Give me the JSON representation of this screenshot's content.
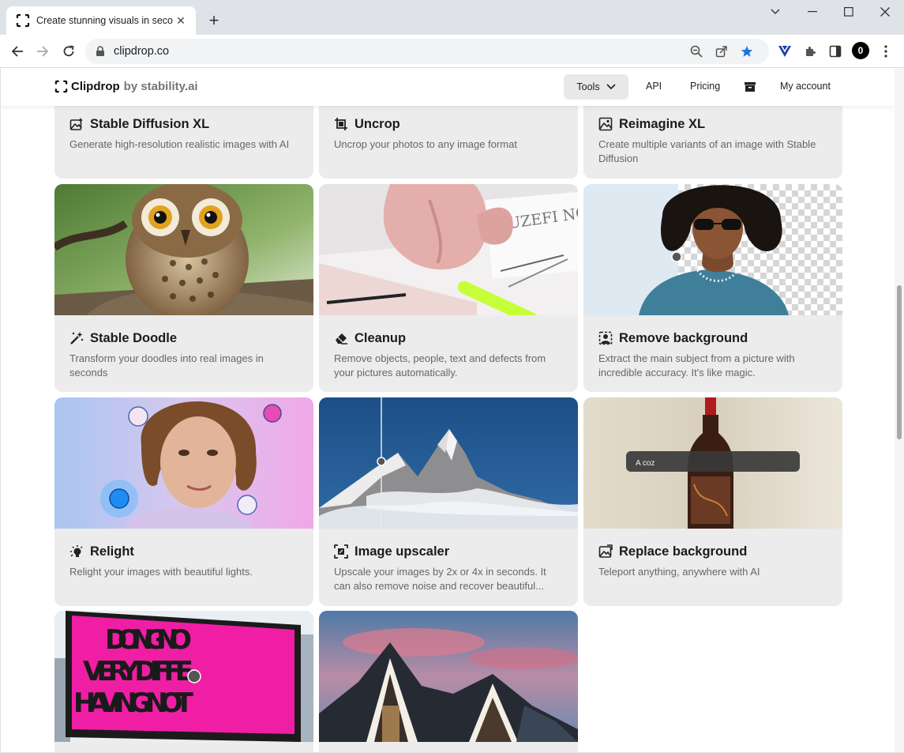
{
  "browser": {
    "tab_title": "Create stunning visuals in seco",
    "url": "clipdrop.co",
    "profile_initial": "0"
  },
  "header": {
    "brand": "Clipdrop",
    "by": "by stability.ai",
    "nav": {
      "tools": "Tools",
      "api": "API",
      "pricing": "Pricing",
      "account": "My account"
    }
  },
  "cards": [
    {
      "title": "Stable Diffusion XL",
      "desc": "Generate high-resolution realistic images with AI"
    },
    {
      "title": "Uncrop",
      "desc": "Uncrop your photos to any image format"
    },
    {
      "title": "Reimagine XL",
      "desc": "Create multiple variants of an image with Stable Diffusion"
    },
    {
      "title": "Stable Doodle",
      "desc": "Transform your doodles into real images in seconds"
    },
    {
      "title": "Cleanup",
      "desc": "Remove objects, people, text and defects from your pictures automatically."
    },
    {
      "title": "Remove background",
      "desc": "Extract the main subject from a picture with incredible accuracy. It's like magic."
    },
    {
      "title": "Relight",
      "desc": "Relight your images with beautiful lights."
    },
    {
      "title": "Image upscaler",
      "desc": "Upscale your images by 2x or 4x in seconds. It can also remove noise and recover beautiful..."
    },
    {
      "title": "Replace background",
      "desc": "Teleport anything, anywhere with AI"
    }
  ],
  "images": {
    "cleanup_sign_text": "YUZEFI NOODLES",
    "replace_bg_prompt": "A coz",
    "billboard_lines": [
      "DOING NO",
      "VERY DIFFE",
      "HAVING NOT"
    ]
  },
  "colors": {
    "accent_blue": "#1a73e8",
    "card_bg": "#ececec"
  }
}
